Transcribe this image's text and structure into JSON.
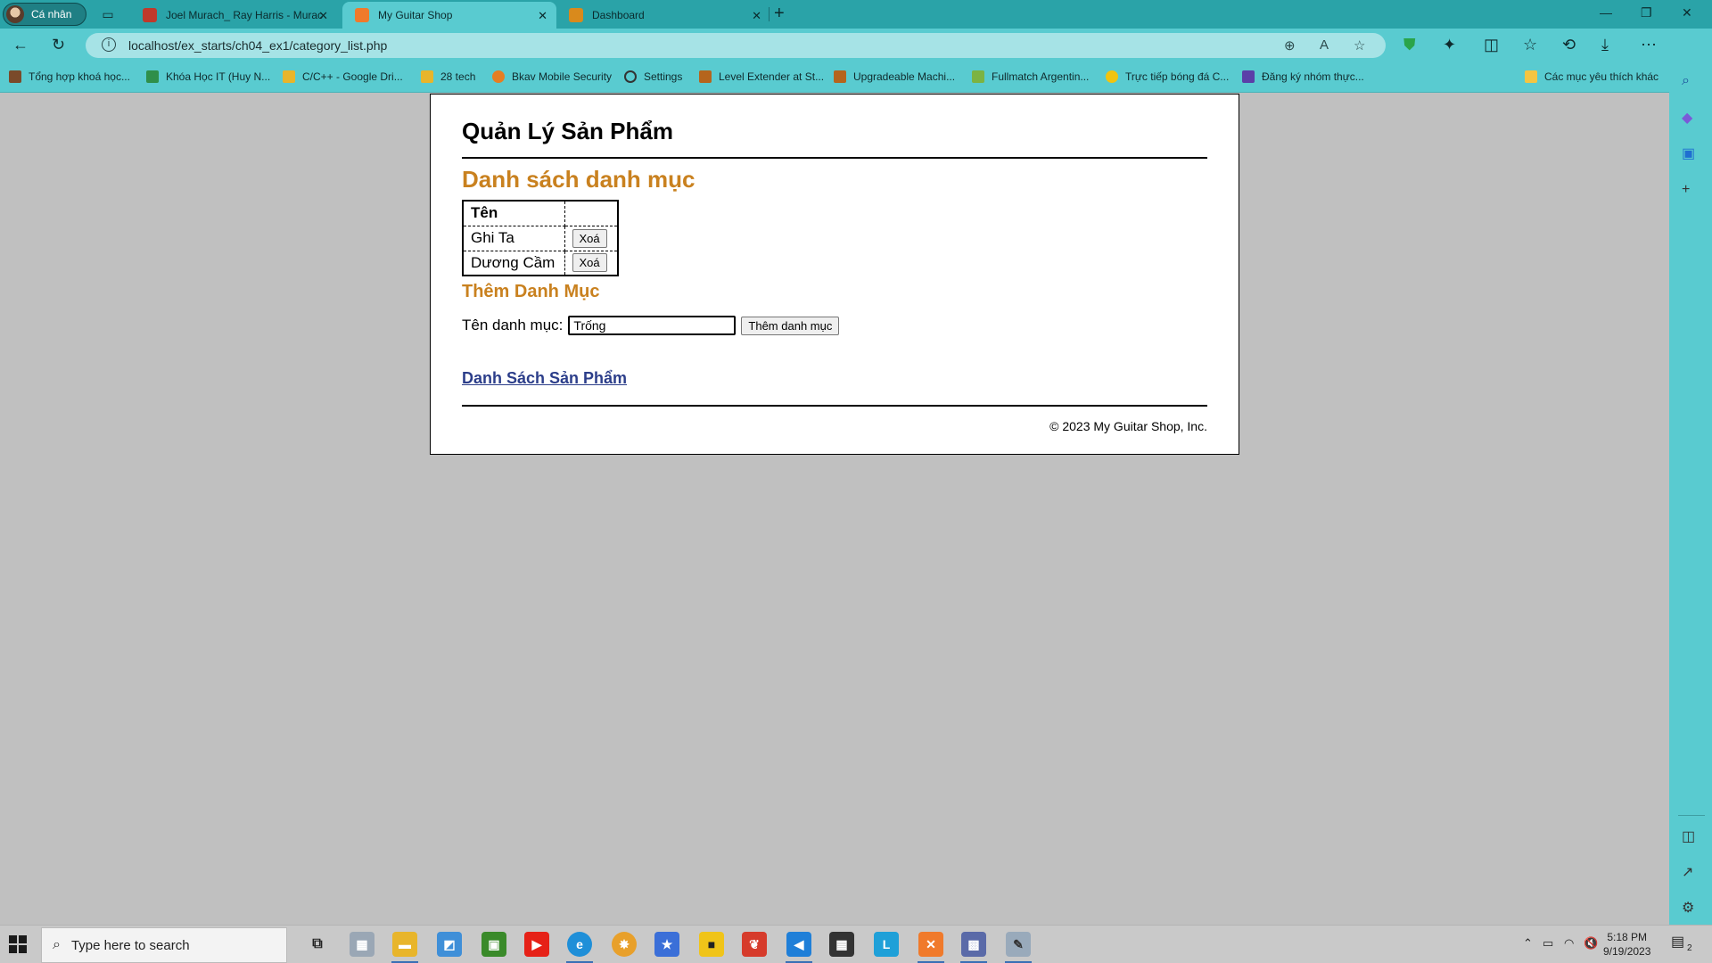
{
  "browser": {
    "profile_label": "Cá nhân",
    "tabs": [
      {
        "title": "Joel Murach_ Ray Harris - Murac"
      },
      {
        "title": "My Guitar Shop"
      },
      {
        "title": "Dashboard"
      }
    ],
    "url": "localhost/ex_starts/ch04_ex1/category_list.php",
    "bookmarks": [
      {
        "label": "Tổng hợp khoá học..."
      },
      {
        "label": "Khóa Học IT (Huy N..."
      },
      {
        "label": "C/C++ - Google Dri..."
      },
      {
        "label": "28 tech"
      },
      {
        "label": "Bkav Mobile Security"
      },
      {
        "label": "Settings"
      },
      {
        "label": "Level Extender at St..."
      },
      {
        "label": "Upgradeable Machi..."
      },
      {
        "label": "Fullmatch Argentin..."
      },
      {
        "label": "Trực tiếp bóng đá C..."
      },
      {
        "label": "Đăng ký nhóm thực..."
      }
    ],
    "favorites_folder": "Các mục yêu thích khác"
  },
  "page": {
    "header_title": "Quản Lý Sản Phẩm",
    "list_title": "Danh sách danh mục",
    "table": {
      "column_name": "Tên",
      "rows": [
        {
          "name": "Ghi Ta",
          "action": "Xoá"
        },
        {
          "name": "Dương Cầm",
          "action": "Xoá"
        }
      ]
    },
    "add_title": "Thêm Danh Mục",
    "form": {
      "label": "Tên danh mục:",
      "input_value": "Trống",
      "submit": "Thêm danh mục"
    },
    "products_link": "Danh Sách Sản Phẩm",
    "footer": "© 2023 My Guitar Shop, Inc."
  },
  "taskbar": {
    "search_placeholder": "Type here to search",
    "time": "5:18 PM",
    "date": "9/19/2023",
    "notifications": "2"
  },
  "colors": {
    "accent_heading": "#c9811f",
    "link": "#2c3e8a",
    "chrome": "#59cbd0"
  }
}
